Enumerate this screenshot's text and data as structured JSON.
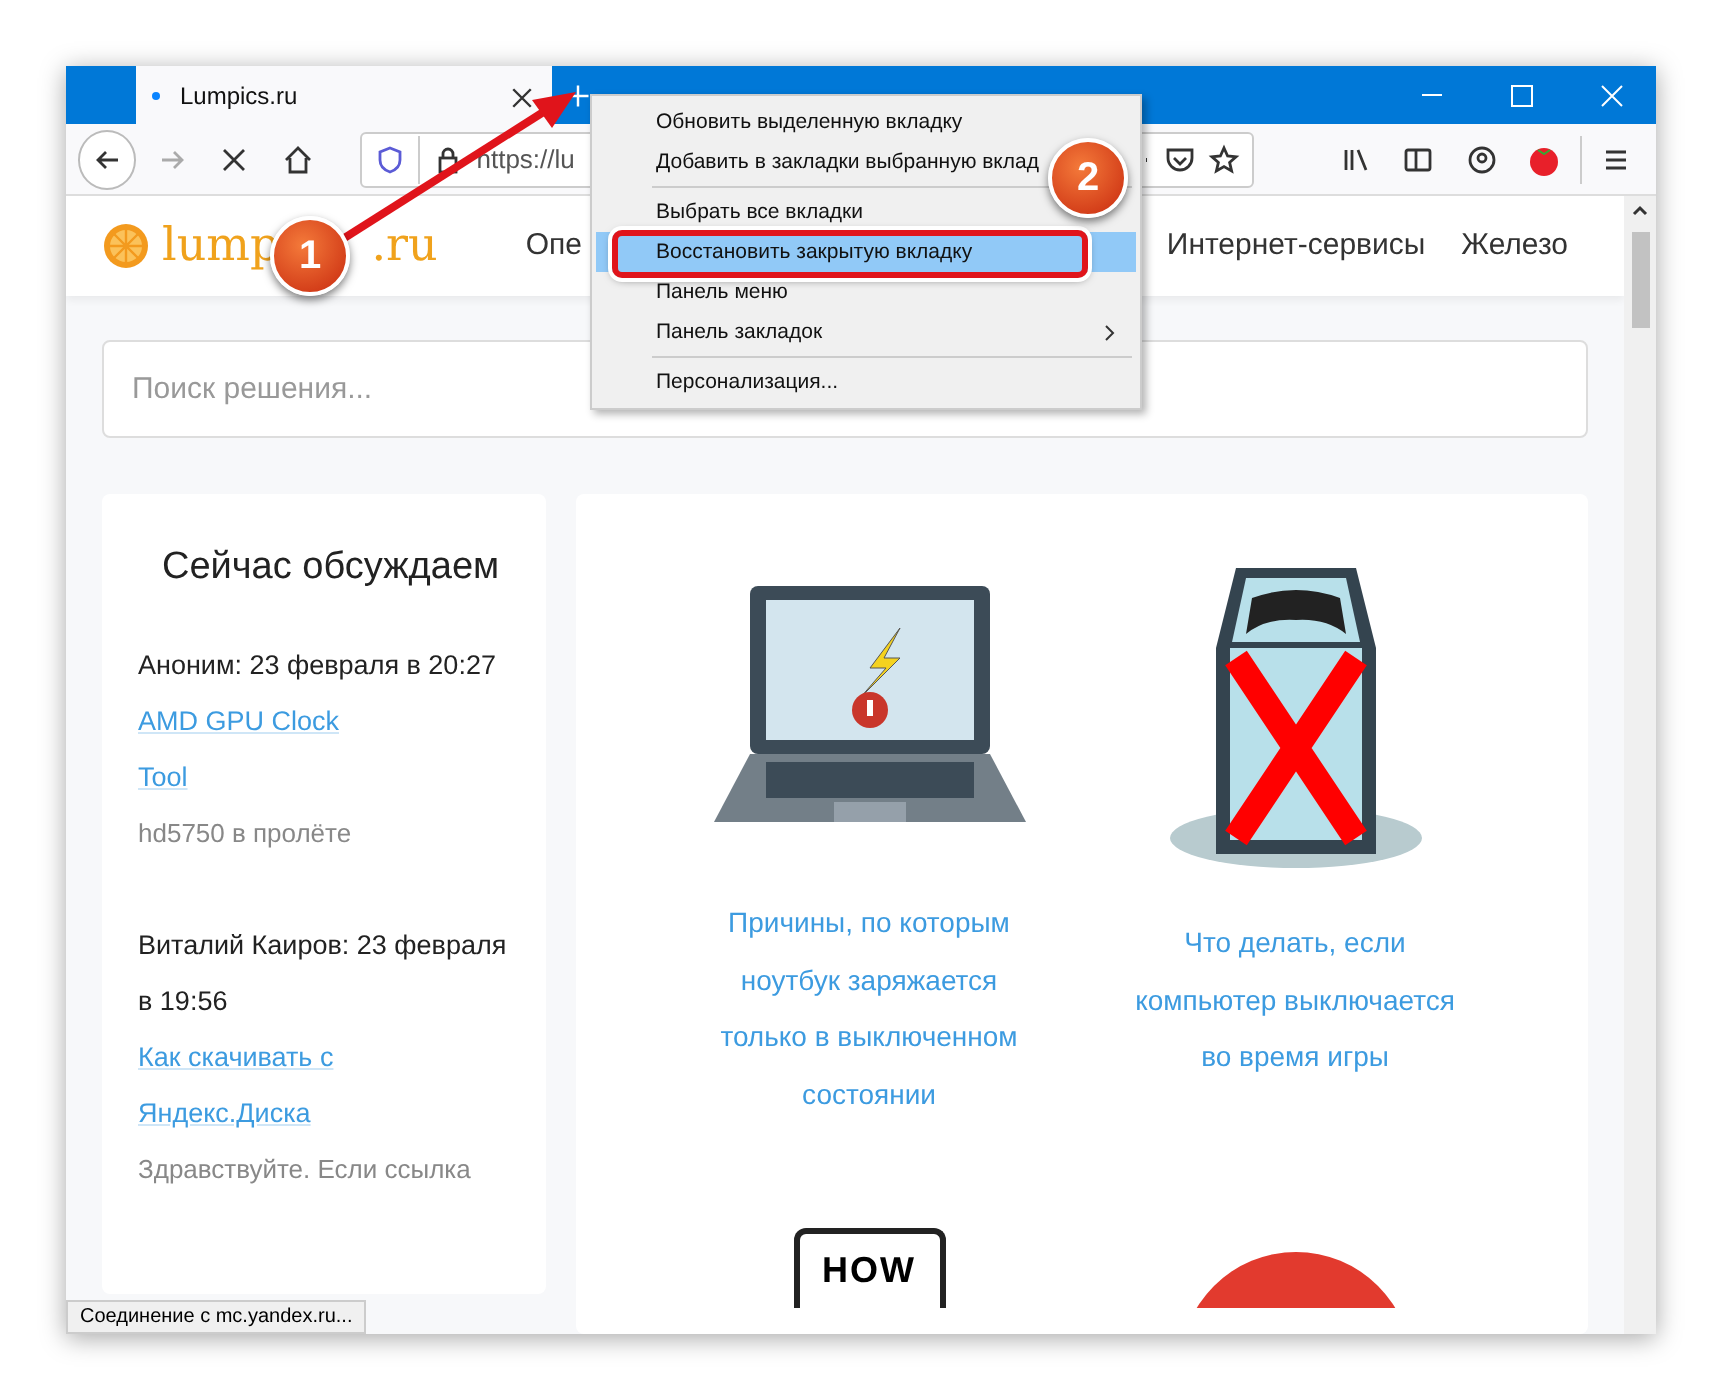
{
  "tab": {
    "title": "Lumpics.ru",
    "selected": true
  },
  "address_bar": {
    "url": "https://lu"
  },
  "site": {
    "logo": [
      "lump",
      ".ru"
    ],
    "nav": [
      "Опе",
      "Интернет-сервисы",
      "Железо"
    ]
  },
  "search": {
    "placeholder": "Поиск решения..."
  },
  "sidebar": {
    "title": "Сейчас обсуждаем",
    "comments": [
      {
        "author": "Аноним: 23 февраля в 20:27",
        "link": "AMD GPU Clock Tool",
        "excerpt": "hd5750 в пролёте"
      },
      {
        "author": "Виталий Каиров: 23 февраля в 19:56",
        "link": "Как скачивать с Яндекс.Диска",
        "excerpt": "Здравствуйте. Если ссылка"
      }
    ]
  },
  "articles": [
    {
      "kind": "laptop",
      "title": "Причины, по которым ноутбук заряжается только в выключенном состоянии"
    },
    {
      "kind": "tower",
      "title": "Что делать, если компьютер выключается во время игры"
    },
    {
      "kind": "sign",
      "sign_text": "HOW"
    },
    {
      "kind": "ball"
    }
  ],
  "context_menu": [
    {
      "label": "Обновить выделенную вкладку",
      "selected": false
    },
    {
      "label": "Добавить в закладки выбранную вклад",
      "selected": false
    },
    {
      "kind": "separator"
    },
    {
      "label": "Выбрать все вкладки",
      "selected": false
    },
    {
      "label": "Восстановить закрытую вкладку",
      "selected": true
    },
    {
      "label": "Панель меню",
      "selected": false
    },
    {
      "label": "Панель закладок",
      "selected": false,
      "submenu": true
    },
    {
      "kind": "separator"
    },
    {
      "label": "Персонализация...",
      "selected": false
    }
  ],
  "status_bar": "Соединение с mc.yandex.ru...",
  "annotations": [
    "1",
    "2"
  ]
}
